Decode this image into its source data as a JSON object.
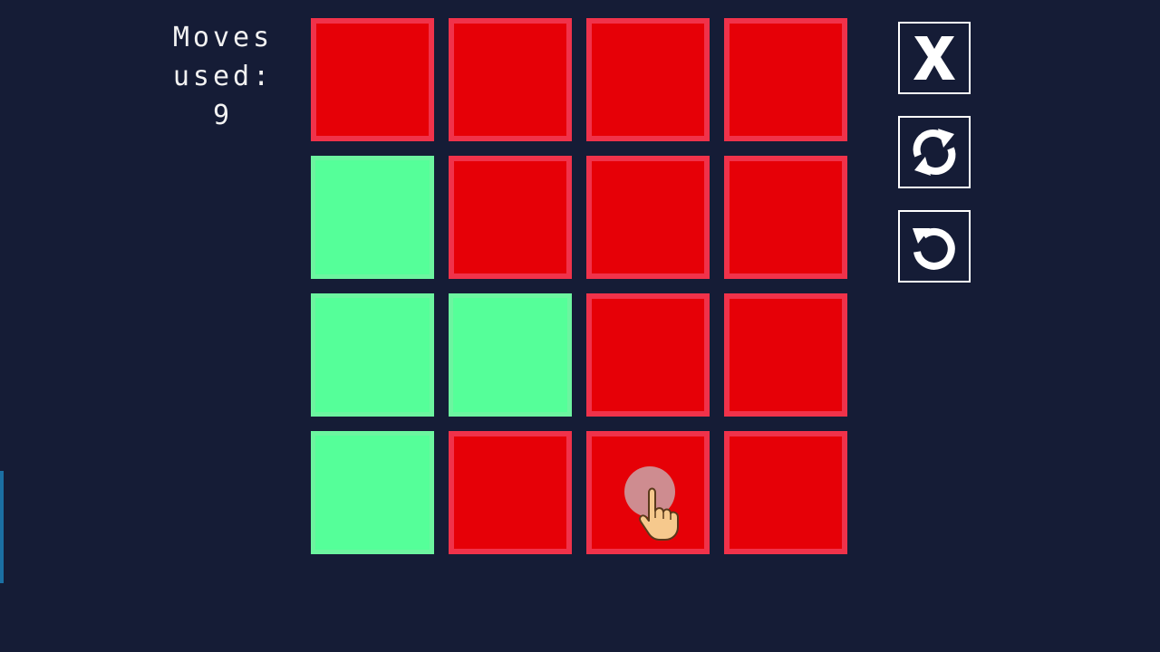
{
  "moves": {
    "line1": "Moves",
    "line2": "used:",
    "count": "9"
  },
  "grid": {
    "rows": [
      [
        "red",
        "red",
        "red",
        "red"
      ],
      [
        "green",
        "red",
        "red",
        "red"
      ],
      [
        "green",
        "green",
        "red",
        "red"
      ],
      [
        "green",
        "red",
        "red",
        "red"
      ]
    ]
  },
  "colors": {
    "background": "#151c36",
    "tile_red": "#e60007",
    "tile_green": "#55ff99",
    "button_border": "#ffffff"
  },
  "toolbar": {
    "close_icon": "x-icon",
    "shuffle_icon": "refresh-arrows-icon",
    "undo_icon": "undo-arrow-icon"
  },
  "cursor": {
    "icon": "pointing-hand-icon",
    "row": 3,
    "column": 2
  }
}
